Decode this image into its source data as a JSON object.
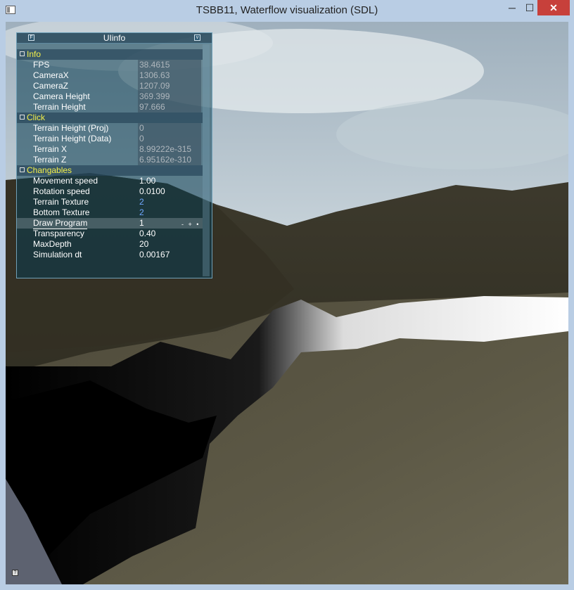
{
  "window": {
    "title": "TSBB11, Waterflow visualization (SDL)",
    "minimize_label": "─",
    "maximize_label": "☐",
    "close_label": "✕"
  },
  "panel": {
    "title": "UIinfo",
    "left_button_label": "F",
    "right_button_label": "v",
    "groups": [
      {
        "label": "Info",
        "rows": [
          {
            "label": "FPS",
            "value": "38.4615"
          },
          {
            "label": "CameraX",
            "value": "1306.63"
          },
          {
            "label": "CameraZ",
            "value": "1207.09"
          },
          {
            "label": "Camera Height",
            "value": "369.399"
          },
          {
            "label": "Terrain Height",
            "value": "97.666"
          }
        ]
      },
      {
        "label": "Click",
        "rows": [
          {
            "label": "Terrain Height (Proj)",
            "value": "0"
          },
          {
            "label": "Terrain Height (Data)",
            "value": "0"
          },
          {
            "label": "Terrain X",
            "value": "8.99222e-315"
          },
          {
            "label": "Terrain Z",
            "value": "6.95162e-310"
          }
        ]
      },
      {
        "label": "Changables",
        "rows": [
          {
            "label": "Movement speed",
            "value": "1.00"
          },
          {
            "label": "Rotation speed",
            "value": "0.0100"
          },
          {
            "label": "Terrain Texture",
            "value": "2"
          },
          {
            "label": "Bottom Texture",
            "value": "2"
          },
          {
            "label": "Draw Program",
            "value": "1",
            "stepper": "- + •"
          },
          {
            "label": "Transparency",
            "value": "0.40"
          },
          {
            "label": "MaxDepth",
            "value": "20"
          },
          {
            "label": "Simulation dt",
            "value": "0.00167"
          }
        ]
      }
    ]
  },
  "colors": {
    "titlebar": "#b9cde4",
    "close": "#c7403b",
    "group_label": "#f3f04a",
    "panel_bg": "#0a3c50"
  },
  "corner_button_label": "?"
}
